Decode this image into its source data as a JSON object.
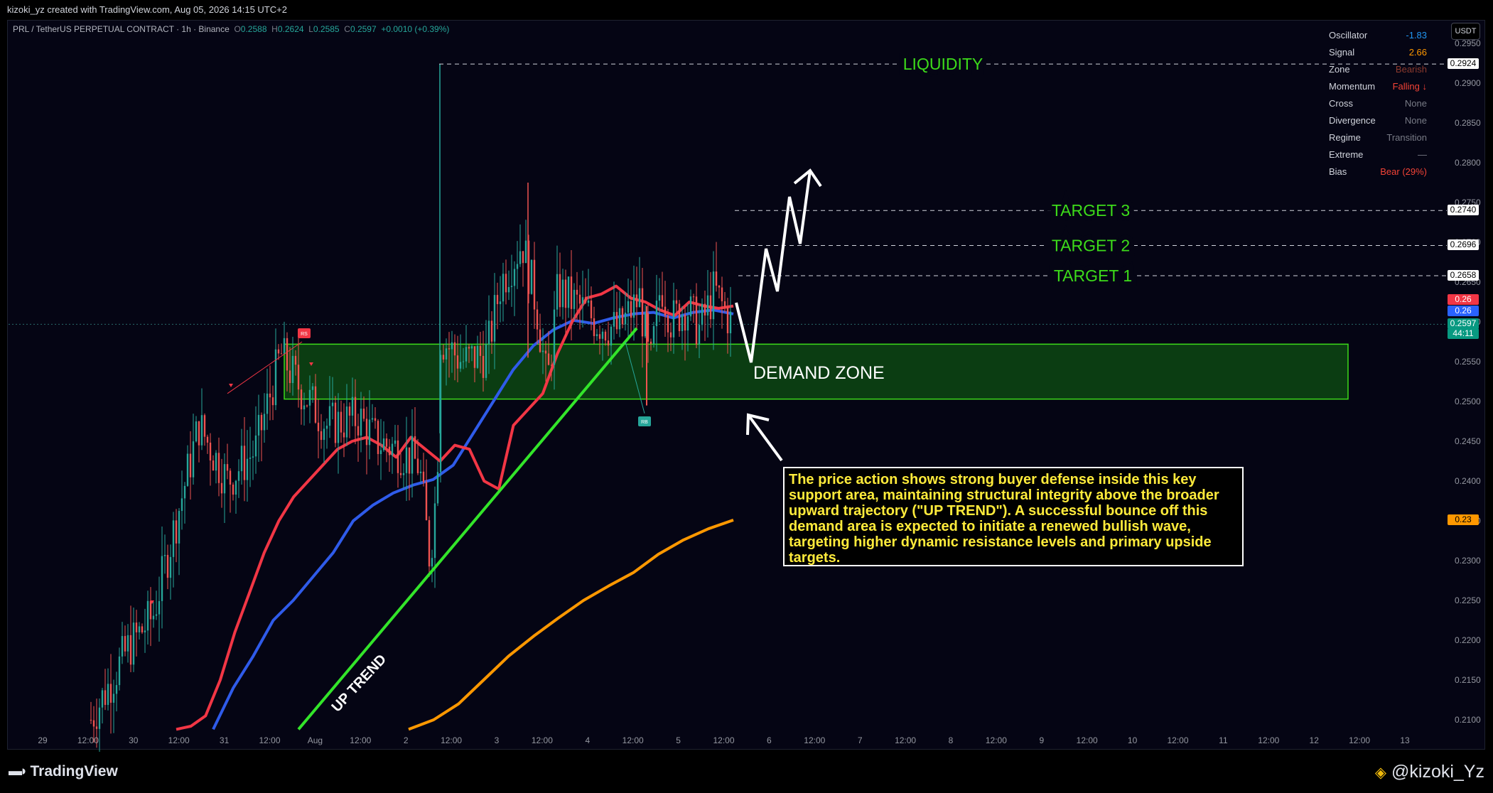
{
  "attribution": "kizoki_yz created with TradingView.com, Aug 05, 2026 14:15 UTC+2",
  "symbol": {
    "name": "PRL / TetherUS PERPETUAL CONTRACT · 1h · Binance",
    "o_label": "O",
    "o": "0.2588",
    "h_label": "H",
    "h": "0.2624",
    "l_label": "L",
    "l": "0.2585",
    "c_label": "C",
    "c": "0.2597",
    "change": "+0.0010 (+0.39%)"
  },
  "currency_button": "USDT",
  "oscillator_panel": [
    {
      "label": "Oscillator",
      "value": "-1.83",
      "color": "#2196f3"
    },
    {
      "label": "Signal",
      "value": "2.66",
      "color": "#ff9800"
    },
    {
      "label": "Zone",
      "value": "Bearish",
      "color": "#8d3a2e"
    },
    {
      "label": "Momentum",
      "value": "Falling ↓",
      "color": "#f44336"
    },
    {
      "label": "Cross",
      "value": "None",
      "color": "#787b86"
    },
    {
      "label": "Divergence",
      "value": "None",
      "color": "#787b86"
    },
    {
      "label": "Regime",
      "value": "Transition",
      "color": "#787b86"
    },
    {
      "label": "Extreme",
      "value": "—",
      "color": "#787b86"
    },
    {
      "label": "Bias",
      "value": "Bear (29%)",
      "color": "#f44336"
    }
  ],
  "annotations": {
    "liquidity": "LIQUIDITY",
    "target3": "TARGET 3",
    "target2": "TARGET 2",
    "target1": "TARGET 1",
    "demand_zone": "DEMAND ZONE",
    "up_trend": "UP TREND",
    "note": "The price action shows strong buyer defense inside this key support area, maintaining structural integrity above the broader upward trajectory (\"UP TREND\"). A successful bounce off this demand area is expected to initiate a renewed bullish wave, targeting higher dynamic resistance levels and primary upside targets."
  },
  "price_tags": [
    {
      "text": "0.2924",
      "bg": "#ffffff",
      "fg": "#000000",
      "price": 0.2924
    },
    {
      "text": "0.2740",
      "bg": "#ffffff",
      "fg": "#000000",
      "price": 0.274
    },
    {
      "text": "0.2696",
      "bg": "#ffffff",
      "fg": "#000000",
      "price": 0.2696
    },
    {
      "text": "0.2658",
      "bg": "#ffffff",
      "fg": "#000000",
      "price": 0.2658
    },
    {
      "text": "0.26",
      "bg": "#f23645",
      "fg": "#ffffff",
      "price": 0.2628
    },
    {
      "text": "0.26",
      "bg": "#2962ff",
      "fg": "#ffffff",
      "price": 0.2613
    },
    {
      "text": "0.2597",
      "bg": "#089981",
      "fg": "#ffffff",
      "price": 0.2597
    },
    {
      "text": "44:11",
      "bg": "#089981",
      "fg": "#ffffff",
      "price": 0.2585
    },
    {
      "text": "0.23",
      "bg": "#ff9800",
      "fg": "#000000",
      "price": 0.2351
    }
  ],
  "markers": {
    "sell": "RS",
    "buy": "RB"
  },
  "branding": {
    "logo": "TradingView",
    "watermark": "@kizoki_Yz"
  },
  "chart_data": {
    "type": "candlestick",
    "title": "PRL / TetherUS PERPETUAL CONTRACT · 1h · Binance",
    "y_axis": {
      "ticks": [
        "0.2950",
        "0.2900",
        "0.2850",
        "0.2800",
        "0.2750",
        "0.2700",
        "0.2650",
        "0.2600",
        "0.2550",
        "0.2500",
        "0.2450",
        "0.2400",
        "0.2350",
        "0.2300",
        "0.2250",
        "0.2200",
        "0.2150",
        "0.2100"
      ],
      "range": [
        0.2088,
        0.2955
      ]
    },
    "x_axis": {
      "ticks": [
        "29",
        "12:00",
        "30",
        "12:00",
        "31",
        "12:00",
        "Aug",
        "12:00",
        "2",
        "12:00",
        "3",
        "12:00",
        "4",
        "12:00",
        "5",
        "12:00",
        "6",
        "12:00",
        "7",
        "12:00",
        "8",
        "12:00",
        "9",
        "12:00",
        "10",
        "12:00",
        "11",
        "12:00",
        "12",
        "12:00",
        "13"
      ]
    },
    "levels": {
      "liquidity": 0.2924,
      "target3": 0.274,
      "target2": 0.2696,
      "target1": 0.2658
    },
    "demand_zone": {
      "from": 0.2503,
      "to": 0.2572
    },
    "last_price": 0.2597,
    "ema_fast_points": [
      [
        0.2088,
        0.2045
      ],
      [
        0.2092,
        0.2065
      ],
      [
        0.2105,
        0.2085
      ],
      [
        0.215,
        0.2105
      ],
      [
        0.221,
        0.2125
      ],
      [
        0.226,
        0.2145
      ],
      [
        0.231,
        0.2165
      ],
      [
        0.235,
        0.2185
      ],
      [
        0.238,
        0.2205
      ],
      [
        0.24,
        0.2225
      ],
      [
        0.242,
        0.2245
      ],
      [
        0.244,
        0.2265
      ],
      [
        0.245,
        0.2285
      ],
      [
        0.2455,
        0.2305
      ],
      [
        0.2445,
        0.2325
      ],
      [
        0.243,
        0.2345
      ],
      [
        0.2455,
        0.236
      ],
      [
        0.244,
        0.2375
      ],
      [
        0.2425,
        0.239
      ],
      [
        0.2445,
        0.2405
      ],
      [
        0.244,
        0.242
      ],
      [
        0.24,
        0.244
      ],
      [
        0.239,
        0.2455
      ],
      [
        0.247,
        0.247
      ],
      [
        0.249,
        0.249
      ],
      [
        0.251,
        0.251
      ],
      [
        0.256,
        0.253
      ],
      [
        0.26,
        0.255
      ],
      [
        0.263,
        0.257
      ],
      [
        0.2635,
        0.259
      ],
      [
        0.2645,
        0.261
      ],
      [
        0.263,
        0.263
      ],
      [
        0.2625,
        0.265
      ],
      [
        0.2615,
        0.266
      ],
      [
        0.2608,
        0.267
      ],
      [
        0.2625,
        0.268
      ],
      [
        0.262,
        0.269
      ],
      [
        0.2617,
        0.27
      ],
      [
        0.262,
        0.271
      ]
    ],
    "ema_mid_points": [
      [
        0.2088,
        0.2095
      ],
      [
        0.214,
        0.2125
      ],
      [
        0.218,
        0.2155
      ],
      [
        0.2225,
        0.2185
      ],
      [
        0.225,
        0.2215
      ],
      [
        0.228,
        0.2245
      ],
      [
        0.231,
        0.2275
      ],
      [
        0.235,
        0.2305
      ],
      [
        0.237,
        0.2335
      ],
      [
        0.2385,
        0.2365
      ],
      [
        0.2395,
        0.239
      ],
      [
        0.2402,
        0.2415
      ],
      [
        0.242,
        0.2435
      ],
      [
        0.246,
        0.2455
      ],
      [
        0.25,
        0.2475
      ],
      [
        0.254,
        0.2495
      ],
      [
        0.257,
        0.2515
      ],
      [
        0.259,
        0.2535
      ],
      [
        0.2602,
        0.2555
      ],
      [
        0.2598,
        0.2575
      ],
      [
        0.2605,
        0.2595
      ],
      [
        0.261,
        0.2615
      ],
      [
        0.2612,
        0.2635
      ],
      [
        0.2605,
        0.2655
      ],
      [
        0.2612,
        0.2675
      ],
      [
        0.2615,
        0.2695
      ],
      [
        0.261,
        0.271
      ]
    ],
    "ema_slow_points": [
      [
        0.2088,
        0.236
      ],
      [
        0.21,
        0.24
      ],
      [
        0.212,
        0.244
      ],
      [
        0.215,
        0.248
      ],
      [
        0.218,
        0.252
      ],
      [
        0.2205,
        0.256
      ],
      [
        0.2228,
        0.26
      ],
      [
        0.225,
        0.264
      ],
      [
        0.2268,
        0.268
      ],
      [
        0.2285,
        0.272
      ],
      [
        0.2308,
        0.276
      ],
      [
        0.2326,
        0.28
      ],
      [
        0.234,
        0.284
      ],
      [
        0.2351,
        0.287
      ]
    ],
    "trendline": [
      [
        0.2088,
        0.2285
      ],
      [
        0.259,
        0.2685
      ]
    ]
  }
}
